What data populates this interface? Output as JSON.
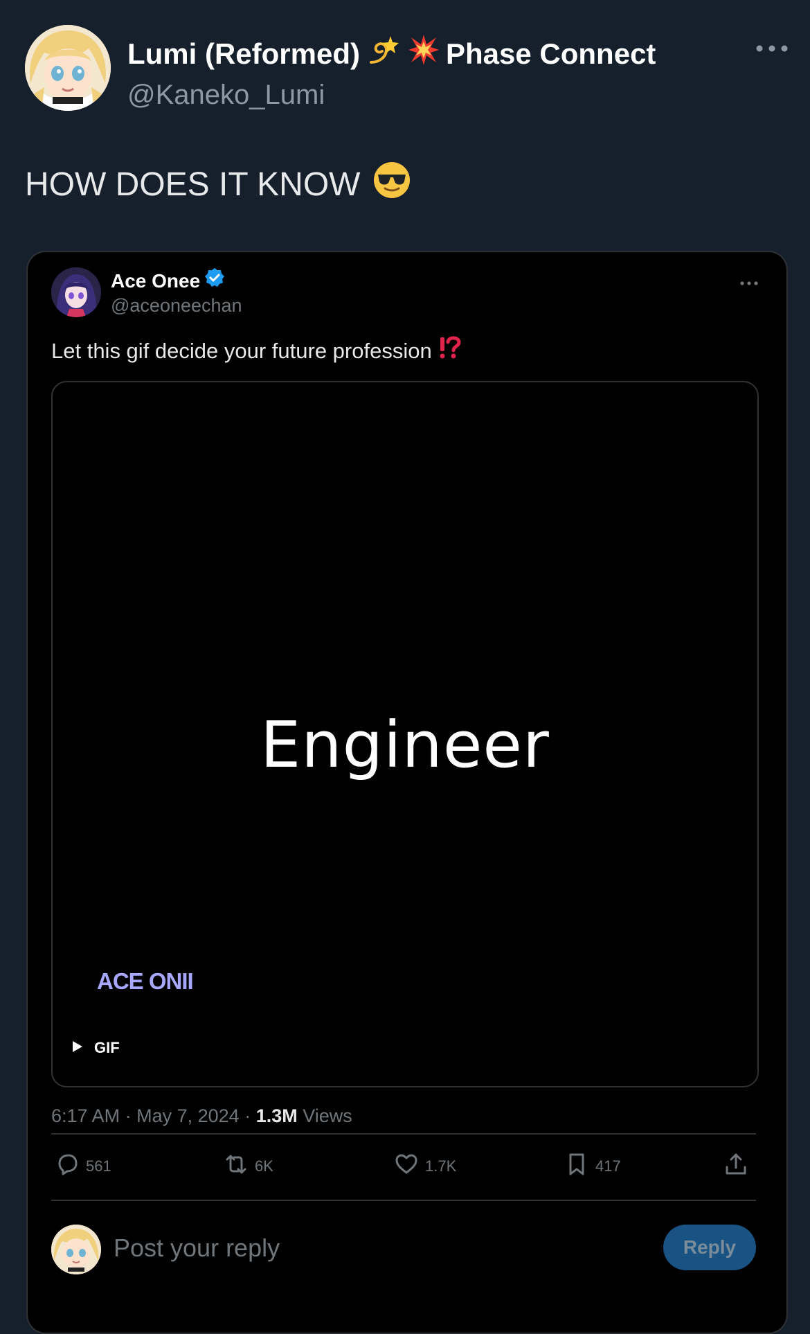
{
  "post": {
    "display_name": "Lumi (Reformed)",
    "name_suffix": "Phase Connect",
    "handle": "@Kaneko_Lumi",
    "text": "HOW DOES IT KNOW",
    "icons": [
      "dizzy-emoji",
      "collision-emoji",
      "more-icon",
      "sunglasses-emoji"
    ]
  },
  "quote": {
    "display_name": "Ace Onee",
    "handle": "@aceoneechan",
    "text": "Let this gif decide your future profession",
    "gif_text": "Engineer",
    "gif_watermark": "ACE ONII",
    "gif_badge": "GIF",
    "time": "6:17 AM",
    "date": "May 7, 2024",
    "views_count": "1.3M",
    "views_label": "Views",
    "icons": [
      "verified-badge-icon",
      "exclamation-question-mark-emoji",
      "more-icon",
      "play-icon"
    ]
  },
  "actions": {
    "replies": "561",
    "reposts": "6K",
    "likes": "1.7K",
    "bookmarks": "417",
    "icons": [
      "reply-icon",
      "repost-icon",
      "like-icon",
      "bookmark-icon",
      "share-icon"
    ]
  },
  "reply_box": {
    "placeholder": "Post your reply",
    "button": "Reply"
  },
  "colors": {
    "outer_background": "#16202c",
    "card_background": "#000000",
    "verified": "#1d9bf0",
    "muted_text": "#71767b",
    "reply_button": "#195384"
  }
}
